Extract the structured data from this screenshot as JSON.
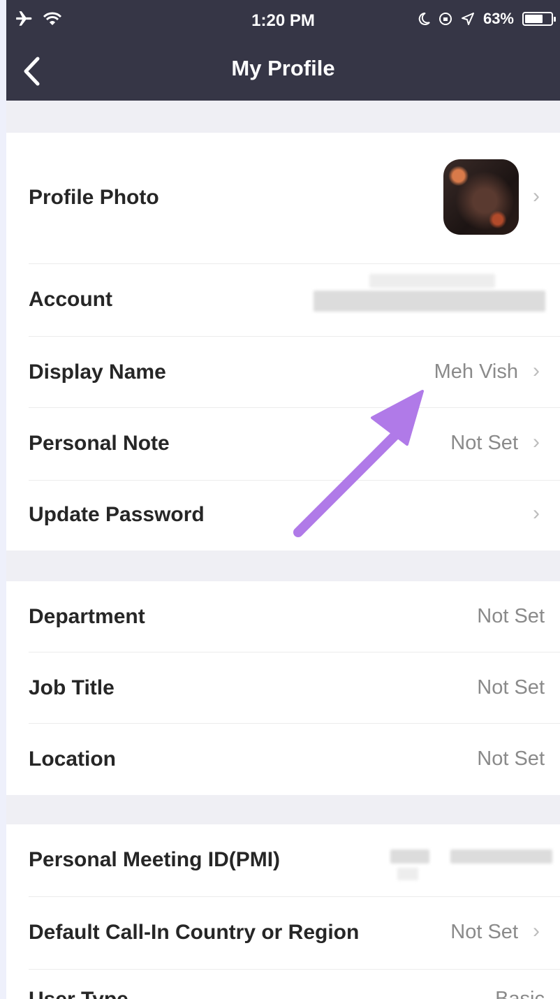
{
  "status_bar": {
    "time": "1:20 PM",
    "battery": "63%",
    "battery_level": 0.63,
    "icons": [
      "airplane-icon",
      "wifi-icon",
      "moon-icon",
      "orientation-lock-icon",
      "location-icon",
      "battery-icon"
    ]
  },
  "nav": {
    "title": "My Profile",
    "back_icon": "chevron-left-icon"
  },
  "colors": {
    "header": "#363646",
    "background": "#efeff4",
    "accent_arrow": "#b07ae8"
  },
  "rows": {
    "profile_photo": {
      "label": "Profile Photo"
    },
    "account": {
      "label": "Account"
    },
    "display_name": {
      "label": "Display Name",
      "value": "Meh Vish"
    },
    "personal_note": {
      "label": "Personal Note",
      "value": "Not Set"
    },
    "update_password": {
      "label": "Update Password"
    },
    "department": {
      "label": "Department",
      "value": "Not Set"
    },
    "job_title": {
      "label": "Job Title",
      "value": "Not Set"
    },
    "location": {
      "label": "Location",
      "value": "Not Set"
    },
    "pmi": {
      "label": "Personal Meeting ID(PMI)"
    },
    "call_in": {
      "label": "Default Call-In Country or Region",
      "value": "Not Set"
    },
    "user_type": {
      "label": "User Type",
      "value": "Basic"
    }
  }
}
